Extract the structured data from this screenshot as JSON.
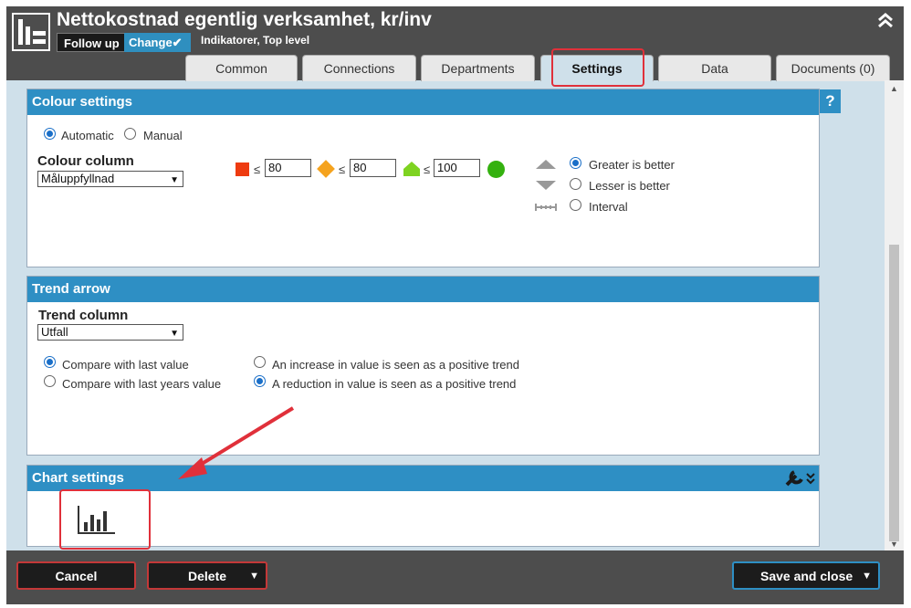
{
  "header": {
    "title": "Nettokostnad egentlig verksamhet, kr/inv",
    "follow_up": "Follow up",
    "change": "Change✔",
    "breadcrumb": "Indikatorer, Top level",
    "collapse_icon": "double-chevron-up-icon"
  },
  "tabs": [
    {
      "label": "Common"
    },
    {
      "label": "Connections"
    },
    {
      "label": "Departments"
    },
    {
      "label": "Settings",
      "active": true
    },
    {
      "label": "Data"
    },
    {
      "label": "Documents (0)"
    }
  ],
  "colour_settings": {
    "title": "Colour settings",
    "help": "?",
    "mode_options": [
      {
        "label": "Automatic",
        "selected": true
      },
      {
        "label": "Manual",
        "selected": false
      }
    ],
    "colour_column_label": "Colour column",
    "colour_column_value": "Måluppfyllnad",
    "thresholds": [
      {
        "shape": "square",
        "color": "#ee3b10",
        "op": "≤",
        "value": "80"
      },
      {
        "shape": "diamond",
        "color": "#f5a31e",
        "op": "≤",
        "value": "80"
      },
      {
        "shape": "house",
        "color": "#7ed321",
        "op": "≤",
        "value": "100"
      }
    ],
    "final_shape": {
      "shape": "circle",
      "color": "#34b10f"
    },
    "direction_options": [
      {
        "label": "Greater is better",
        "selected": true
      },
      {
        "label": "Lesser is better",
        "selected": false
      },
      {
        "label": "Interval",
        "selected": false
      }
    ]
  },
  "trend_arrow": {
    "title": "Trend arrow",
    "trend_column_label": "Trend column",
    "trend_column_value": "Utfall",
    "compare_options": [
      {
        "label": "Compare with last value",
        "selected": true
      },
      {
        "label": "Compare with last years value",
        "selected": false
      }
    ],
    "trend_options": [
      {
        "label": "An increase in value is seen as a positive trend",
        "selected": false
      },
      {
        "label": "A reduction in value is seen as a positive trend",
        "selected": true
      }
    ]
  },
  "chart_settings": {
    "title": "Chart settings",
    "tool_icon": "wrench-icon",
    "chart_icon": "bar-chart-icon"
  },
  "footer": {
    "cancel": "Cancel",
    "delete": "Delete",
    "save_close": "Save and close"
  },
  "colors": {
    "header_bg": "#4d4d4d",
    "panel_head": "#2e8fc4",
    "highlight": "#e0303a"
  }
}
